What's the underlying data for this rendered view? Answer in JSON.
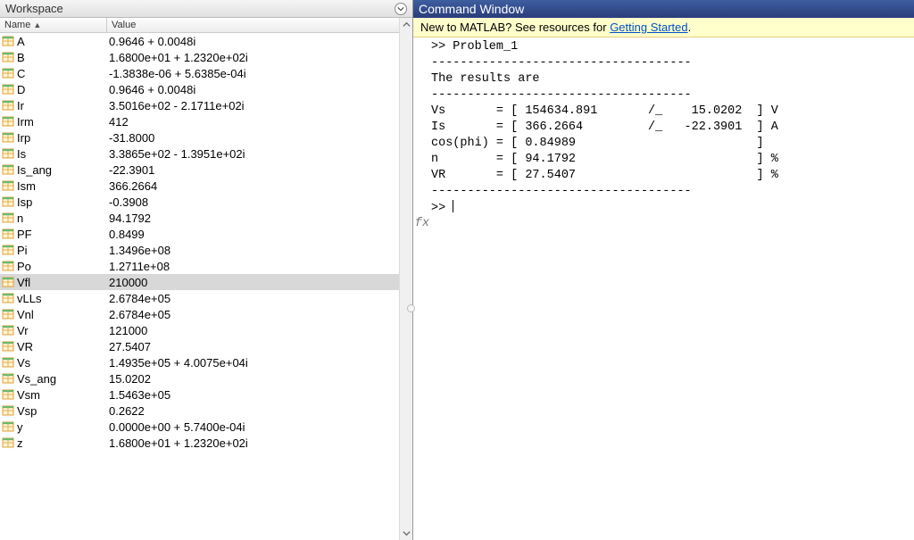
{
  "workspace": {
    "title": "Workspace",
    "columns": {
      "name": "Name",
      "value": "Value"
    },
    "vars": [
      {
        "name": "A",
        "value": "0.9646 + 0.0048i"
      },
      {
        "name": "B",
        "value": "1.6800e+01 + 1.2320e+02i"
      },
      {
        "name": "C",
        "value": "-1.3838e-06 + 5.6385e-04i"
      },
      {
        "name": "D",
        "value": "0.9646 + 0.0048i"
      },
      {
        "name": "Ir",
        "value": "3.5016e+02 - 2.1711e+02i"
      },
      {
        "name": "Irm",
        "value": "412"
      },
      {
        "name": "Irp",
        "value": "-31.8000"
      },
      {
        "name": "Is",
        "value": "3.3865e+02 - 1.3951e+02i"
      },
      {
        "name": "Is_ang",
        "value": "-22.3901"
      },
      {
        "name": "Ism",
        "value": "366.2664"
      },
      {
        "name": "Isp",
        "value": "-0.3908"
      },
      {
        "name": "n",
        "value": "94.1792"
      },
      {
        "name": "PF",
        "value": "0.8499"
      },
      {
        "name": "Pi",
        "value": "1.3496e+08"
      },
      {
        "name": "Po",
        "value": "1.2711e+08"
      },
      {
        "name": "Vfl",
        "value": "210000",
        "selected": true
      },
      {
        "name": "vLLs",
        "value": "2.6784e+05"
      },
      {
        "name": "Vnl",
        "value": "2.6784e+05"
      },
      {
        "name": "Vr",
        "value": "121000"
      },
      {
        "name": "VR",
        "value": "27.5407"
      },
      {
        "name": "Vs",
        "value": "1.4935e+05 + 4.0075e+04i"
      },
      {
        "name": "Vs_ang",
        "value": "15.0202"
      },
      {
        "name": "Vsm",
        "value": "1.5463e+05"
      },
      {
        "name": "Vsp",
        "value": "0.2622"
      },
      {
        "name": "y",
        "value": "0.0000e+00 + 5.7400e-04i"
      },
      {
        "name": "z",
        "value": "1.6800e+01 + 1.2320e+02i"
      }
    ]
  },
  "command": {
    "title": "Command Window",
    "info_prefix": "New to MATLAB? See resources for ",
    "info_link": "Getting Started",
    "info_suffix": ".",
    "output": ">> Problem_1\n------------------------------------\nThe results are\n------------------------------------\nVs       = [ 154634.891       /_    15.0202  ] V\nIs       = [ 366.2664         /_   -22.3901  ] A\ncos(phi) = [ 0.84989                         ]\nn        = [ 94.1792                         ] %\nVR       = [ 27.5407                         ] %\n------------------------------------",
    "prompt": ">> ",
    "fx": "fx"
  }
}
